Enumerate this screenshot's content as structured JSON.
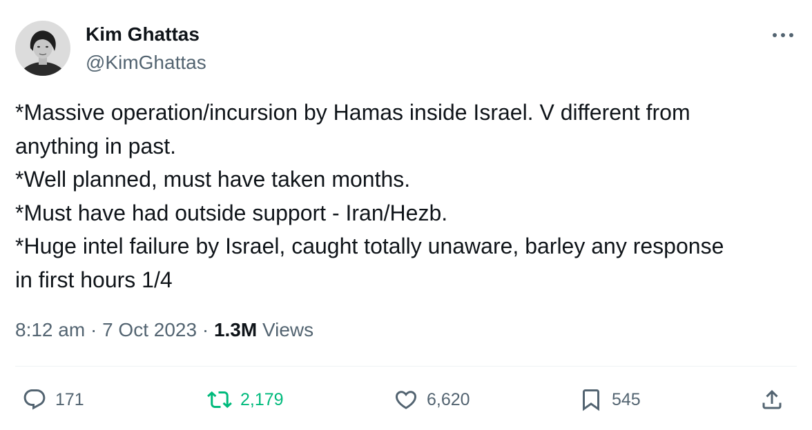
{
  "author": {
    "name": "Kim Ghattas",
    "handle": "@KimGhattas"
  },
  "tweet": {
    "lines": [
      "*Massive operation/incursion by Hamas inside Israel. V different from",
      "anything in past.",
      "*Well planned, must have taken months.",
      "*Must have had outside support - Iran/Hezb.",
      "*Huge intel failure by Israel, caught totally unaware, barley any response",
      "in first hours 1/4"
    ]
  },
  "meta": {
    "time": "8:12 am",
    "separator": "·",
    "date": "7 Oct 2023",
    "views_count": "1.3M",
    "views_label": "Views"
  },
  "actions": {
    "replies": "171",
    "retweets": "2,179",
    "likes": "6,620",
    "bookmarks": "545"
  },
  "icons": {
    "more": "more-horizontal-icon",
    "reply": "reply-icon",
    "retweet": "retweet-icon",
    "like": "heart-icon",
    "bookmark": "bookmark-icon",
    "share": "share-icon"
  },
  "colors": {
    "text_primary": "#0f1419",
    "text_secondary": "#536471",
    "retweet_active": "#00ba7c",
    "divider": "#eff3f4"
  }
}
